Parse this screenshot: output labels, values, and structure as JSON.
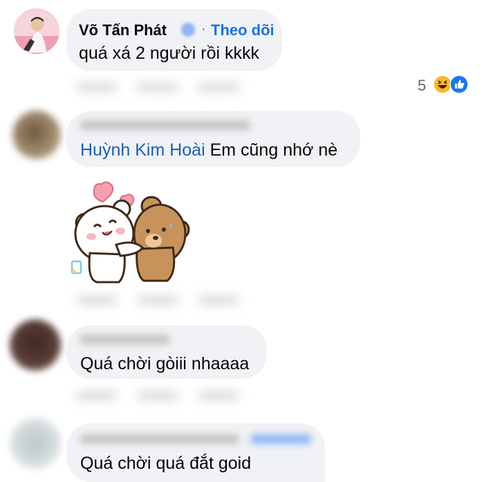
{
  "comments": [
    {
      "author": "Võ Tấn Phát",
      "follow_label": "Theo dõi",
      "separator": "·",
      "text": "quá xá 2 người rồi kkkk",
      "reaction_count": "5"
    },
    {
      "mention": "Huỳnh Kim Hoài",
      "text": " Em cũng nhớ nè"
    },
    {
      "text": "Quá chời gòiii nhaaaa"
    },
    {
      "text": "Quá chời quá đắt goid"
    }
  ],
  "colors": {
    "bubble": "#f0f2f5",
    "link": "#1b74e4",
    "text": "#050505"
  }
}
